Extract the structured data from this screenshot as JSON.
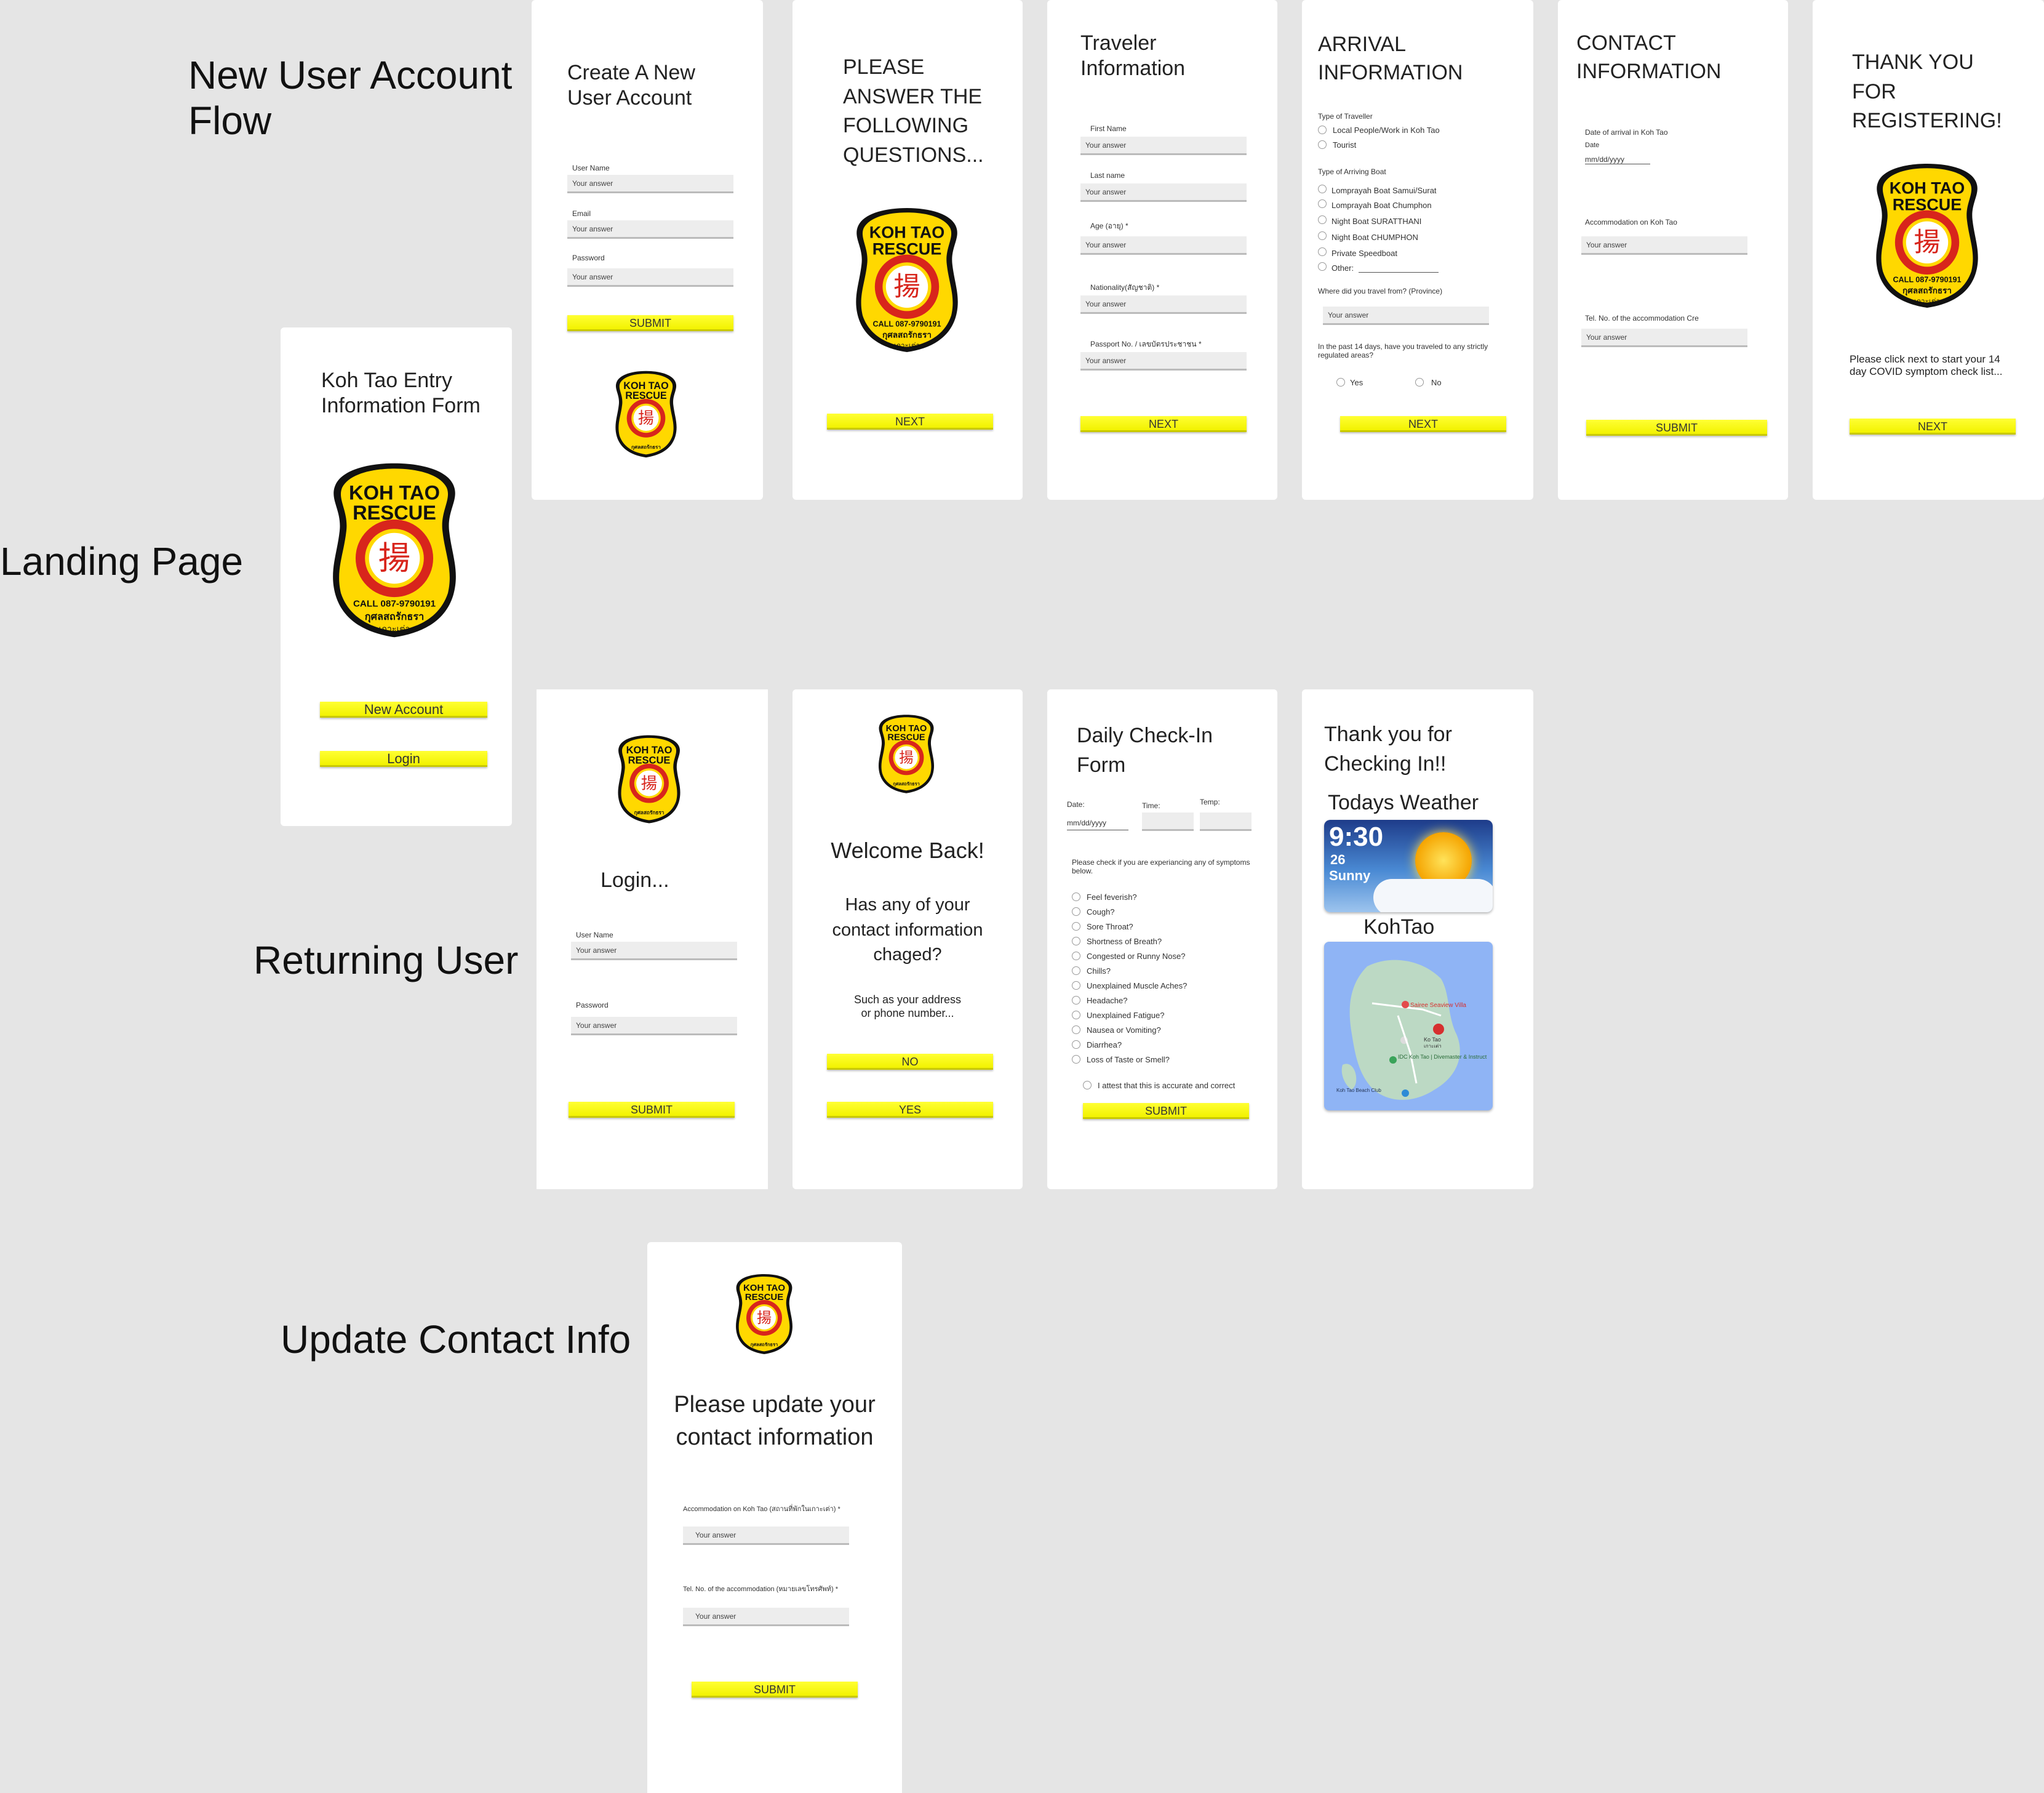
{
  "sections": {
    "new_user": "New User Account Flow",
    "landing": "Landing Page",
    "returning": "Returning User",
    "update": "Update Contact Info"
  },
  "logo": {
    "line1": "KOH TAO",
    "line2": "RESCUE",
    "char": "揚",
    "phone": "CALL 087-9790191",
    "thai1": "กุศลสถรักธรา",
    "thai2": "เกาะเต่า",
    "brand_yellow": "#ffd800",
    "brand_red": "#d8251c"
  },
  "landing": {
    "title": "Koh Tao Entry Information Form",
    "btn_new": "New Account",
    "btn_login": "Login"
  },
  "create": {
    "title": "Create A New User Account",
    "l_user": "User Name",
    "l_email": "Email",
    "l_pass": "Password",
    "ph": "Your answer",
    "submit": "SUBMIT"
  },
  "questions": {
    "title": "PLEASE ANSWER THE FOLLOWING QUESTIONS...",
    "next": "NEXT"
  },
  "traveler": {
    "title": "Traveler Information",
    "l_first": "First Name",
    "l_last": "Last name",
    "l_age": "Age (อายุ) *",
    "l_nat": "Nationality(สัญชาติ) *",
    "l_pass": "Passport No. / เลขบัตรประชาชน *",
    "ph": "Your answer",
    "next": "NEXT"
  },
  "arrival": {
    "title": "ARRIVAL INFORMATION",
    "type_traveller": "Type of Traveller",
    "opt_local": "Local People/Work in Koh Tao",
    "opt_tourist": "Tourist",
    "type_boat": "Type of Arriving Boat",
    "b1": "Lomprayah Boat Samui/Surat",
    "b2": "Lomprayah Boat Chumphon",
    "b3": "Night Boat SURATTHANI",
    "b4": "Night Boat CHUMPHON",
    "b5": "Private Speedboat",
    "b6": "Other:",
    "l_from": "Where did you travel from? (Province)",
    "ph": "Your answer",
    "q14": "In the past 14 days, have you traveled to any strictly regulated areas?",
    "yes": "Yes",
    "no": "No",
    "next": "NEXT"
  },
  "contact": {
    "title": "CONTACT INFORMATION",
    "l_date": "Date of arrival in Koh Tao",
    "l_date_sub": "Date",
    "date_ph": "mm/dd/yyyy",
    "l_accom": "Accommodation on Koh Tao",
    "l_tel": "Tel. No. of the accommodation Cre",
    "ph": "Your answer",
    "submit": "SUBMIT"
  },
  "thanks": {
    "title": "THANK YOU FOR REGISTERING!",
    "body": "Please click next to start your 14 day COVID symptom check list...",
    "next": "NEXT"
  },
  "login": {
    "title": "Login...",
    "l_user": "User Name",
    "l_pass": "Password",
    "ph": "Your answer",
    "submit": "SUBMIT"
  },
  "welcome": {
    "title": "Welcome Back!",
    "q": "Has any of your contact information chaged?",
    "sub": "Such as your address or phone number...",
    "no": "NO",
    "yes": "YES"
  },
  "daily": {
    "title": "Daily Check-In Form",
    "l_date": "Date:",
    "l_time": "Time:",
    "l_temp": "Temp:",
    "date_ph": "mm/dd/yyyy",
    "intro": "Please check if you are experiancing any of symptoms below.",
    "s1": "Feel feverish?",
    "s2": "Cough?",
    "s3": "Sore Throat?",
    "s4": "Shortness of Breath?",
    "s5": "Congested or Runny Nose?",
    "s6": "Chills?",
    "s7": "Unexplained Muscle Aches?",
    "s8": "Headache?",
    "s9": "Unexplained Fatigue?",
    "s10": "Nausea or Vomiting?",
    "s11": "Diarrhea?",
    "s12": "Loss of Taste or Smell?",
    "attest": "I attest that this is accurate and correct",
    "submit": "SUBMIT"
  },
  "checkedin": {
    "title": "Thank you for Checking In!!",
    "weather_title": "Todays Weather",
    "time": "9:30",
    "temp": "26",
    "cond": "Sunny",
    "map_title": "KohTao",
    "pin1": "Sairee Seaview Villa",
    "pin2": "Ko Tao",
    "pin2b": "เกาะเต่า",
    "pin3": "IDC Koh Tao | Divemaster & Instruct",
    "pin4": "Koh Tao Beach Club"
  },
  "update": {
    "title": "Please update your contact information",
    "l_accom": "Accommodation on Koh Tao (สถานที่พักในเกาะเต่า) *",
    "l_tel": "Tel. No. of the accommodation (หมายเลขโทรศัพท์) *",
    "ph": "Your answer",
    "submit": "SUBMIT"
  }
}
